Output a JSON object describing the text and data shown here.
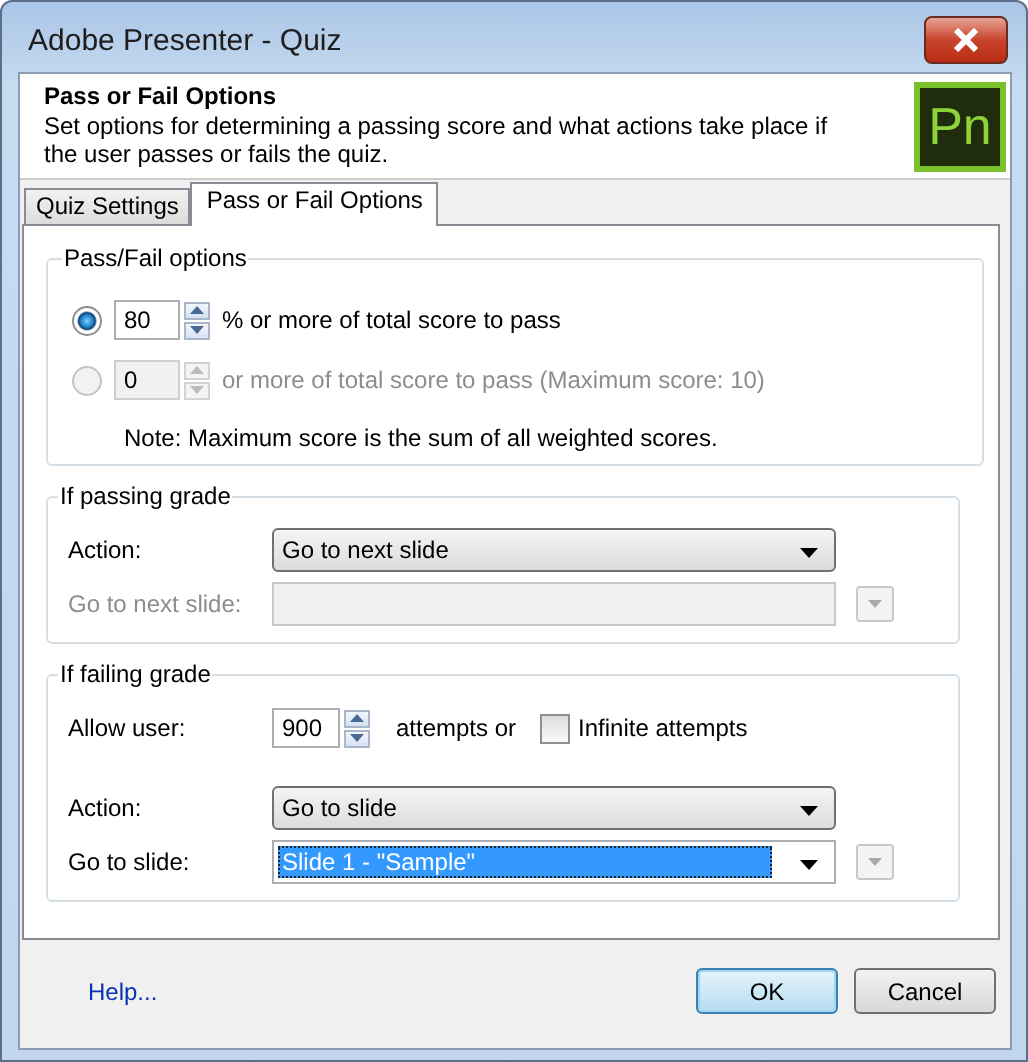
{
  "window": {
    "title": "Adobe Presenter - Quiz"
  },
  "header": {
    "title": "Pass or Fail Options",
    "description": "Set options for determining a passing score and what actions take place if the user passes or fails the quiz.",
    "logo_text": "Pn"
  },
  "tabs": [
    {
      "label": "Quiz Settings",
      "selected": false
    },
    {
      "label": "Pass or Fail Options",
      "selected": true
    }
  ],
  "pass_fail_options": {
    "title": "Pass/Fail options",
    "options": [
      {
        "selected": true,
        "disabled": false,
        "value": "80",
        "text": "% or more of total score to pass"
      },
      {
        "selected": false,
        "disabled": true,
        "value": "0",
        "text": "or more of total score to pass (Maximum score: 10)"
      }
    ],
    "note": "Note: Maximum score is the sum of all weighted scores."
  },
  "groups": [
    {
      "title": "If passing grade",
      "rows": [
        {
          "kind": "dropdown",
          "label": "Action:",
          "value": "Go to next slide",
          "disabled": false
        },
        {
          "kind": "combo",
          "label": "Go to next slide:",
          "disabled": true
        }
      ]
    },
    {
      "title": "If failing grade",
      "rows": [
        {
          "kind": "spin",
          "label": "Allow user:",
          "value": "900",
          "suffix": "attempts or",
          "checkbox": {
            "label": "Infinite attempts",
            "checked": false
          }
        },
        {
          "kind": "dropdown",
          "label": "Action:",
          "value": "Go to slide",
          "disabled": false
        },
        {
          "kind": "combo",
          "label": "Go to slide:",
          "value": "Slide 1 - \"Sample\"",
          "disabled": false,
          "highlighted": true
        }
      ]
    }
  ],
  "footer": {
    "help_link": "Help...",
    "buttons": [
      {
        "label": "OK",
        "default": true
      },
      {
        "label": "Cancel",
        "default": false
      }
    ]
  }
}
